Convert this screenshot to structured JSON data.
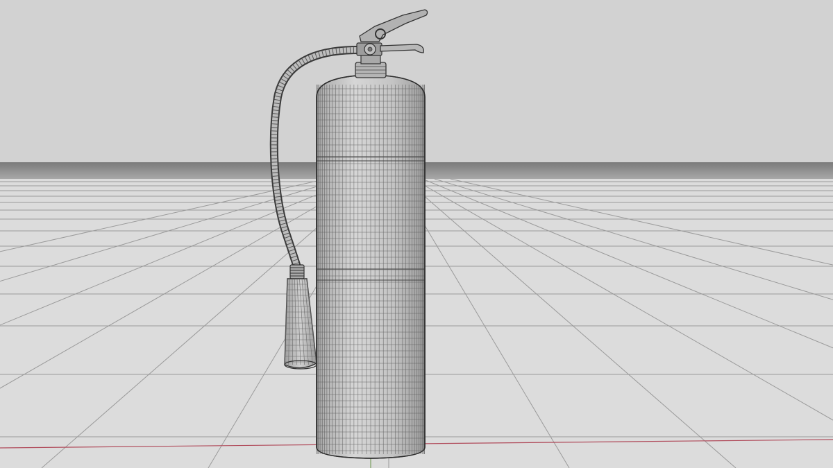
{
  "viewport": {
    "view_mode": "wireframe-shaded-perspective",
    "grid_visible": true,
    "world_axes_visible": true,
    "colors": {
      "sky": "#d2d2d2",
      "floor": "#dcdcdc",
      "grid_line": "#9a9a9a",
      "horizon_band": "#858585",
      "x_axis": "#b04a5a",
      "y_axis": "#7aa060",
      "model_fill": "#c9c9c9",
      "wire": "#4a4a4a"
    }
  },
  "model": {
    "object": "fire-extinguisher",
    "parts": [
      "cylinder-body",
      "neck-valve",
      "carry-handle",
      "trigger-lever",
      "safety-pin-ring",
      "discharge-hose",
      "horn-nozzle"
    ]
  }
}
